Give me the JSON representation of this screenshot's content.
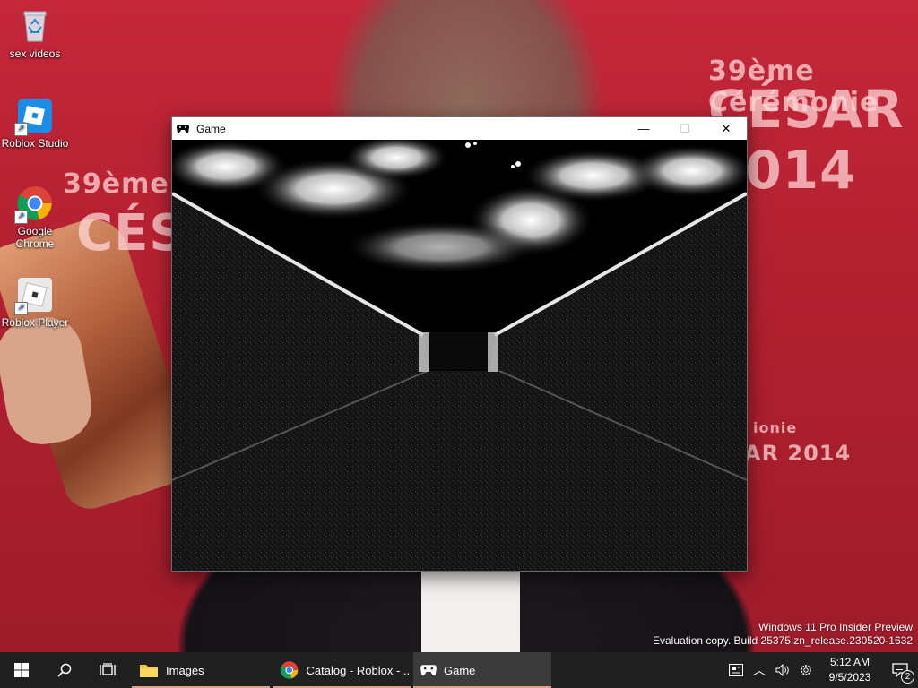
{
  "desktop": {
    "icons": [
      {
        "label": "sex videos",
        "icon": "recycle-bin-icon"
      },
      {
        "label": "Roblox Studio",
        "icon": "roblox-studio-icon"
      },
      {
        "label": "Google Chrome",
        "icon": "chrome-icon"
      },
      {
        "label": "Roblox Player",
        "icon": "roblox-player-icon"
      }
    ]
  },
  "window": {
    "title": "Game",
    "icon": "gamepad-icon",
    "minimize": "—",
    "maximize": "☐",
    "close": "✕"
  },
  "taskbar": {
    "apps": [
      {
        "label": "Images",
        "icon": "folder-icon"
      },
      {
        "label": "Catalog - Roblox - ...",
        "icon": "chrome-icon"
      },
      {
        "label": "Game",
        "icon": "gamepad-icon"
      }
    ],
    "clock_time": "5:12 AM",
    "clock_date": "9/5/2023",
    "notifications_count": "2"
  },
  "watermark": {
    "line1": "Windows 11 Pro Insider Preview",
    "line2": "Evaluation copy. Build 25375.zn_release.230520-1632"
  },
  "wallpaper": {
    "text1": "39ème Cérémonie",
    "text2": "CÉSAR 2014",
    "text3": "39ème Cé",
    "text4": "CÉS",
    "text5": "ionie",
    "text6": "AR 2014"
  }
}
